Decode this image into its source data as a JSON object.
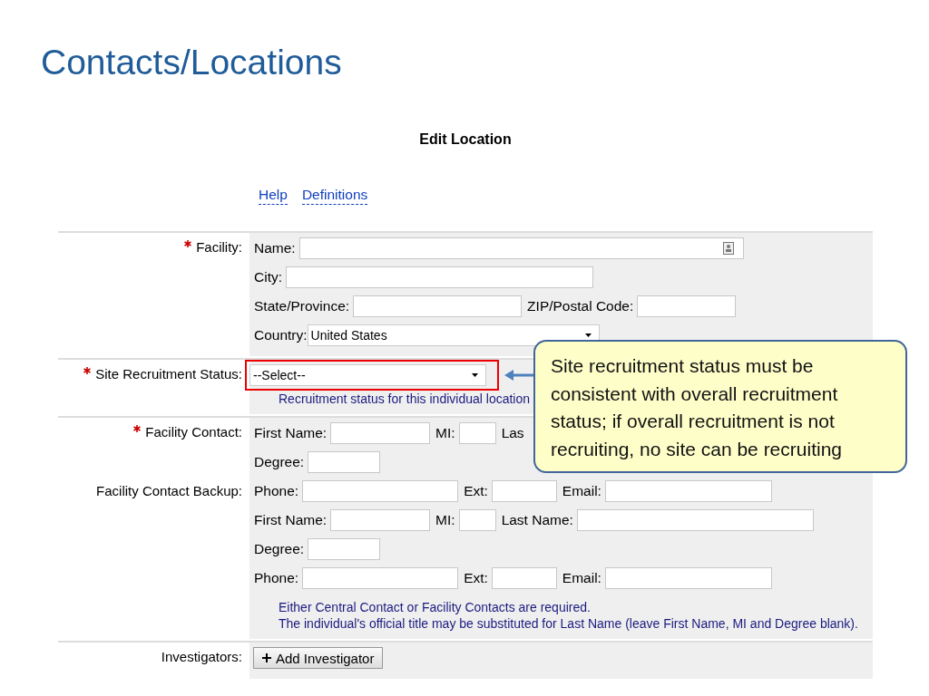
{
  "slide_title": "Contacts/Locations",
  "form": {
    "title": "Edit Location",
    "links": [
      "Help",
      "Definitions"
    ],
    "sections": [
      {
        "labels": [
          {
            "text": "Facility:",
            "required": true
          }
        ],
        "rows": [
          [
            {
              "label": "Name:",
              "kind": "lookup"
            }
          ],
          [
            {
              "label": "City:",
              "kind": "input"
            }
          ],
          [
            {
              "label": "State/Province:",
              "kind": "input"
            },
            {
              "label": "ZIP/Postal Code:",
              "kind": "input"
            }
          ],
          [
            {
              "label": "Country:",
              "kind": "select",
              "value": "United States",
              "highlighted": false
            }
          ]
        ]
      },
      {
        "labels": [
          {
            "text": "Site Recruitment Status:",
            "required": true
          }
        ],
        "rows": [
          [
            {
              "kind": "select",
              "value": "--Select--",
              "highlighted": true
            }
          ]
        ],
        "notes": [
          "Recruitment status for this individual location"
        ]
      },
      {
        "labels": [
          {
            "text": "Facility Contact:",
            "required": true
          },
          {
            "text": "Facility Contact Backup:",
            "required": false
          }
        ],
        "rows": [
          [
            {
              "label": "First Name:",
              "kind": "input"
            },
            {
              "label": "MI:",
              "kind": "input"
            },
            {
              "label": "Las",
              "kind": "label"
            }
          ],
          [
            {
              "label": "Degree:",
              "kind": "input"
            }
          ],
          [
            {
              "label": "Phone:",
              "kind": "input"
            },
            {
              "label": "Ext:",
              "kind": "input"
            },
            {
              "label": "Email:",
              "kind": "input"
            }
          ],
          [
            {
              "label": "First Name:",
              "kind": "input"
            },
            {
              "label": "MI:",
              "kind": "input"
            },
            {
              "label": "Last Name:",
              "kind": "input"
            }
          ],
          [
            {
              "label": "Degree:",
              "kind": "input"
            }
          ],
          [
            {
              "label": "Phone:",
              "kind": "input"
            },
            {
              "label": "Ext:",
              "kind": "input"
            },
            {
              "label": "Email:",
              "kind": "input"
            }
          ]
        ],
        "notes": [
          "Either Central Contact or Facility Contacts are required.",
          "The individual's official title may be substituted for Last Name (leave First Name, MI and Degree blank)."
        ]
      },
      {
        "labels": [
          {
            "text": "Investigators:",
            "required": false
          }
        ],
        "rows": [
          [
            {
              "label": "Add Investigator",
              "kind": "button"
            }
          ]
        ]
      }
    ]
  },
  "callout": {
    "text": "Site recruitment status must be consistent with overall recruitment status; if overall recruitment is not recruiting, no site can be recruiting"
  }
}
